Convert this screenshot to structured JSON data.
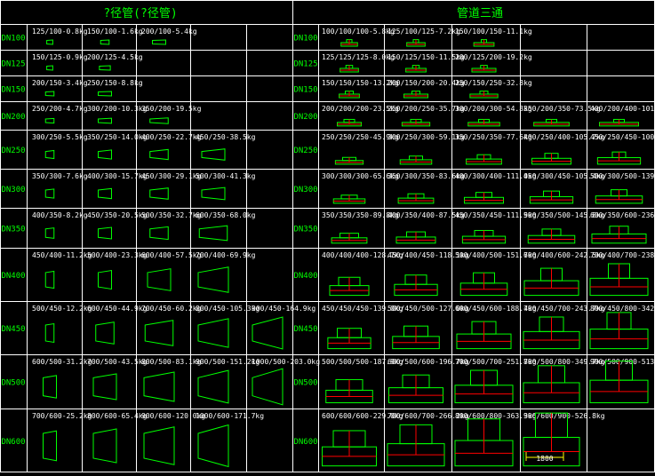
{
  "headers": {
    "left": "?径管(?径管)",
    "right": "管道三通"
  },
  "colors": {
    "background": "#000000",
    "grid": "#ffffff",
    "label_green": "#00ff00",
    "text_white": "#ffffff",
    "shape_green": "#00ff00",
    "accent_red": "#ff0000",
    "dim_yellow": "#ffff00"
  },
  "rows": [
    {
      "dn": "DN100",
      "reducers": [
        "125/100-0.8kg",
        "150/100-1.6kg",
        "200/100-5.4kg"
      ],
      "tees": [
        "100/100/100-5.8kg",
        "125/100/125-7.2kg",
        "150/100/150-11.1kg"
      ]
    },
    {
      "dn": "DN125",
      "reducers": [
        "150/125-0.9kg",
        "200/125-4.5kg"
      ],
      "tees": [
        "125/125/125-8.0kg",
        "150/125/150-11.5kg",
        "200/125/200-19.2kg"
      ]
    },
    {
      "dn": "DN150",
      "reducers": [
        "200/150-3.4kg",
        "250/150-8.8kg"
      ],
      "tees": [
        "150/150/150-13.2kg",
        "200/150/200-20.4kg",
        "250/150/250-32.8kg"
      ]
    },
    {
      "dn": "DN200",
      "reducers": [
        "250/200-4.7kg",
        "300/200-10.3kg",
        "350/200-19.5kg"
      ],
      "tees": [
        "200/200/200-23.5kg",
        "250/200/250-35.7kg",
        "300/200/300-54.8kg",
        "350/200/350-73.5kg",
        "400/200/400-101.2kg"
      ]
    },
    {
      "dn": "DN250",
      "reducers": [
        "300/250-5.5kg",
        "350/250-14.0kg",
        "400/250-22.7kg",
        "450/250-38.5kg"
      ],
      "tees": [
        "250/250/250-45.9kg",
        "300/250/300-59.1kg",
        "350/250/350-77.6kg",
        "400/250/400-105.7kg",
        "450/250/450-100.8kg"
      ]
    },
    {
      "dn": "DN300",
      "reducers": [
        "350/300-7.6kg",
        "400/300-15.7kg",
        "450/300-29.1kg",
        "500/300-41.3kg"
      ],
      "tees": [
        "300/300/300-65.6kg",
        "350/300/350-83.6kg",
        "400/300/400-111.0kg",
        "450/300/450-105.4kg",
        "500/300/500-139.5kg"
      ]
    },
    {
      "dn": "DN350",
      "reducers": [
        "400/350-8.2kg",
        "450/350-20.5kg",
        "500/350-32.7kg",
        "600/350-68.0kg"
      ],
      "tees": [
        "350/350/350-89.8kg",
        "400/350/400-87.5kg",
        "450/350/450-111.9kg",
        "500/350/500-145.8kg",
        "600/350/600-236.8kg"
      ]
    },
    {
      "dn": "DN400",
      "reducers": [
        "450/400-11.2kg",
        "500/400-23.3kg",
        "600/400-57.5kg",
        "700/400-69.9kg"
      ],
      "tees": [
        "400/400/400-128.7kg",
        "450/400/450-118.1kg",
        "500/400/500-151.7kg",
        "600/400/600-242.5kg",
        "700/400/700-238.7kg"
      ]
    },
    {
      "dn": "DN450",
      "reducers": [
        "500/450-12.2kg",
        "600/450-44.9kg",
        "700/450-60.2kg",
        "800/450-105.3kg",
        "900/450-164.9kg"
      ],
      "tees": [
        "450/450/450-139.0kg",
        "500/450/500-127.0kg",
        "600/450/600-188.4kg",
        "700/450/700-243.7kg",
        "800/450/800-342.7kg"
      ]
    },
    {
      "dn": "DN500",
      "reducers": [
        "600/500-31.2kg",
        "700/500-43.5kg",
        "800/500-83.1kg",
        "900/500-151.2kg",
        "1000/500-203.0kg"
      ],
      "tees": [
        "500/500/500-187.9kg",
        "600/500/600-196.7kg",
        "700/500/700-251.7kg",
        "800/500/800-349.7kg",
        "900/500/900-513.7kg"
      ]
    },
    {
      "dn": "DN600",
      "reducers": [
        "700/600-25.2kg",
        "800/600-65.4kg",
        "900/600-120.0kg",
        "1000/600-171.7kg"
      ],
      "tees": [
        "600/600/600-229.0kg",
        "700/600/700-266.2kg",
        "800/600/800-363.3kg",
        "900/600/900-526.8kg"
      ]
    }
  ],
  "dimension_label": "1800"
}
